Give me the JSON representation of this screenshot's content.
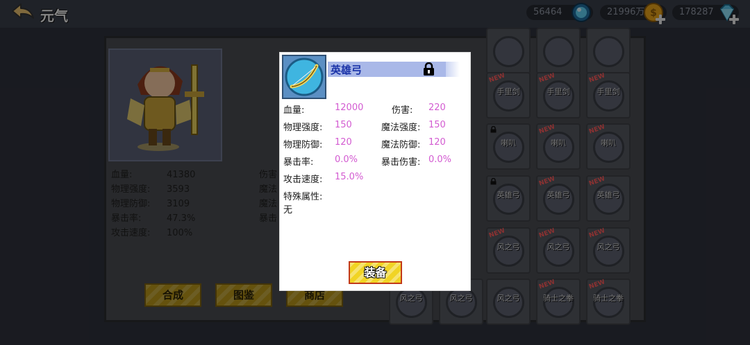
{
  "header": {
    "title": "元气",
    "currencies": [
      {
        "name": "gem-blue",
        "value": "56464",
        "color": "#36a7d8"
      },
      {
        "name": "gold-coin",
        "value": "21996万",
        "color": "#e8a21a"
      },
      {
        "name": "diamond",
        "value": "178287",
        "color": "#5ac2e8"
      }
    ]
  },
  "hero": {
    "stats_left": [
      {
        "label": "血量:",
        "value": "41380"
      },
      {
        "label": "物理强度:",
        "value": "3593"
      },
      {
        "label": "物理防御:",
        "value": "3109"
      },
      {
        "label": "暴击率:",
        "value": "47.3%"
      },
      {
        "label": "攻击速度:",
        "value": "100%"
      }
    ],
    "stats_right_labels": [
      "伤害",
      "魔法",
      "魔法",
      "暴击"
    ]
  },
  "bottom_buttons": [
    "合成",
    "图鉴",
    "商店"
  ],
  "inventory": {
    "rows": [
      [
        {
          "label": "",
          "new": false,
          "locked": false
        },
        {
          "label": "",
          "new": false,
          "locked": false
        },
        {
          "label": "",
          "new": false,
          "locked": false
        }
      ],
      [
        {
          "label": "手里剑",
          "new": true,
          "locked": false
        },
        {
          "label": "手里剑",
          "new": true,
          "locked": false
        },
        {
          "label": "手里剑",
          "new": true,
          "locked": false
        }
      ],
      [
        {
          "label": "喇叭",
          "new": false,
          "locked": true
        },
        {
          "label": "喇叭",
          "new": true,
          "locked": false
        },
        {
          "label": "喇叭",
          "new": true,
          "locked": false
        }
      ],
      [
        {
          "label": "英雄弓",
          "new": false,
          "locked": true
        },
        {
          "label": "英雄弓",
          "new": true,
          "locked": false
        },
        {
          "label": "英雄弓",
          "new": true,
          "locked": false
        }
      ],
      [
        {
          "label": "风之弓",
          "new": true,
          "locked": false
        },
        {
          "label": "风之弓",
          "new": true,
          "locked": false
        },
        {
          "label": "风之弓",
          "new": true,
          "locked": false
        }
      ],
      [
        {
          "label": "风之弓",
          "new": true,
          "locked": false
        },
        {
          "label": "风之弓",
          "new": true,
          "locked": false
        },
        {
          "label": "风之弓",
          "new": false,
          "locked": false
        },
        {
          "label": "骑士之拳",
          "new": true,
          "locked": false
        },
        {
          "label": "骑士之拳",
          "new": true,
          "locked": false
        }
      ]
    ]
  },
  "item_dialog": {
    "name": "英雄弓",
    "locked": true,
    "stats": [
      {
        "label": "血量:",
        "value": "12000",
        "label2": "伤害:",
        "value2": "220"
      },
      {
        "label": "物理强度:",
        "value": "150",
        "label2": "魔法强度:",
        "value2": "150"
      },
      {
        "label": "物理防御:",
        "value": "120",
        "label2": "魔法防御:",
        "value2": "120"
      },
      {
        "label": "暴击率:",
        "value": "0.0%",
        "label2": "暴击伤害:",
        "value2": "0.0%"
      },
      {
        "label": "攻击速度:",
        "value": "15.0%",
        "label2": "",
        "value2": ""
      }
    ],
    "special_label": "特殊属性:",
    "special_value": "无",
    "equip_label": "装备",
    "value_color": "#d35bd1"
  }
}
